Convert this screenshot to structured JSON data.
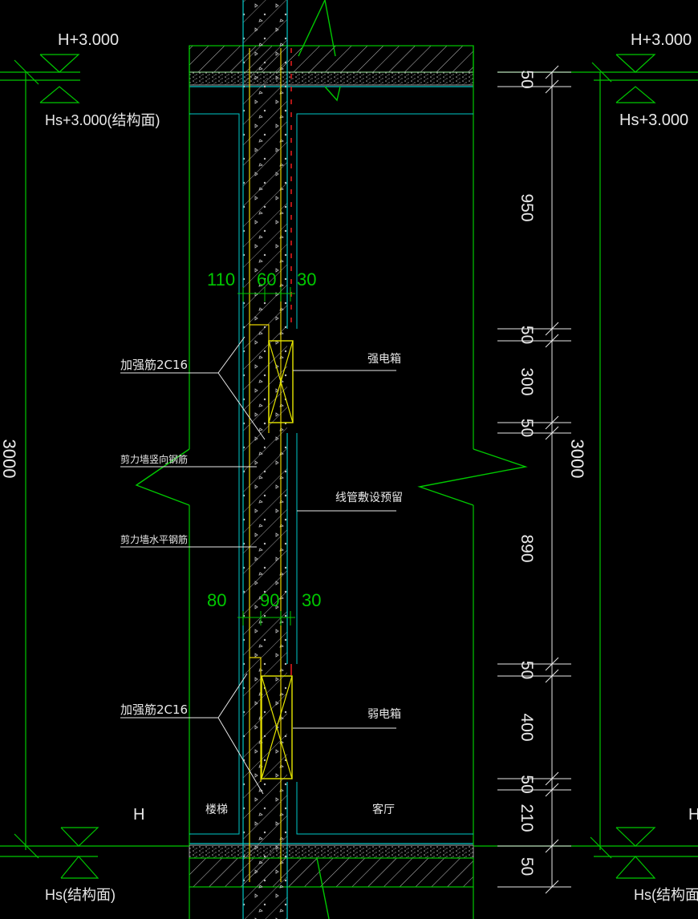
{
  "colors": {
    "background": "#000000",
    "outline": "#00c800",
    "finish": "#00c8c8",
    "concrete": "#c8c8c8",
    "rebar": "#e6d200",
    "box": "#e6e600",
    "accent": "#ff2020",
    "text": "#e8e8e8"
  },
  "levels": {
    "top_left": "H+3.000",
    "top_left_struct": "Hs+3.000(结构面)",
    "top_right": "H+3.000",
    "top_right_struct": "Hs+3.000",
    "bottom_left": "H",
    "bottom_left_struct": "Hs(结构面)",
    "bottom_right": "H",
    "bottom_right_struct": "Hs(结构面)"
  },
  "dimensions": {
    "left_total": "3000",
    "right_total": "3000",
    "chain": [
      "50",
      "950",
      "50",
      "300",
      "50",
      "890",
      "50",
      "400",
      "50",
      "210",
      "50"
    ],
    "upper_widths": [
      "110",
      "60",
      "30"
    ],
    "lower_widths": [
      "80",
      "90",
      "30"
    ]
  },
  "annotations": {
    "rebar_upper": "加强筋2C16",
    "vertical_rebar": "剪力墙竖向钢筋",
    "horizontal_rebar": "剪力墙水平钢筋",
    "rebar_lower": "加强筋2C16",
    "strong_box": "强电箱",
    "conduit": "线管敷设预留",
    "weak_box": "弱电箱",
    "room_left": "楼梯",
    "room_right": "客厅"
  }
}
